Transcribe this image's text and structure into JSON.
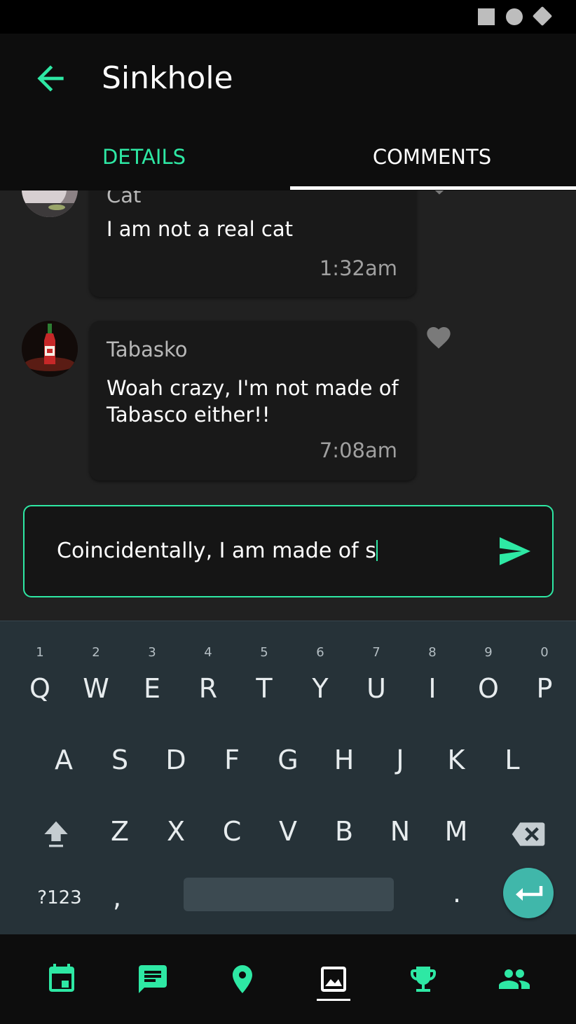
{
  "app_bar": {
    "title": "Sinkhole",
    "tabs": [
      {
        "label": "DETAILS",
        "active": false
      },
      {
        "label": "COMMENTS",
        "active": true
      }
    ],
    "accent_color": "#2ee8a4"
  },
  "comments": [
    {
      "author": "Cat",
      "text": "I am not a real cat",
      "time": "1:32am"
    },
    {
      "author": "Tabasko",
      "text": "Woah crazy, I'm not made of Tabasco either!!",
      "time": "7:08am"
    }
  ],
  "composer": {
    "value": "Coincidentally, I am made of s"
  },
  "keyboard": {
    "row1": [
      "Q",
      "W",
      "E",
      "R",
      "T",
      "Y",
      "U",
      "I",
      "O",
      "P"
    ],
    "row1_hints": [
      "1",
      "2",
      "3",
      "4",
      "5",
      "6",
      "7",
      "8",
      "9",
      "0"
    ],
    "row2": [
      "A",
      "S",
      "D",
      "F",
      "G",
      "H",
      "J",
      "K",
      "L"
    ],
    "row3": [
      "Z",
      "X",
      "C",
      "V",
      "B",
      "N",
      "M"
    ],
    "symbols_label": "?123",
    "comma_label": ",",
    "period_label": "."
  },
  "bottom_nav": {
    "items": [
      "calendar-icon",
      "chat-icon",
      "location-icon",
      "image-icon",
      "trophy-icon",
      "people-icon"
    ],
    "active": "image-icon"
  },
  "status_icons": [
    "square-icon",
    "circle-icon",
    "diamond-icon"
  ]
}
